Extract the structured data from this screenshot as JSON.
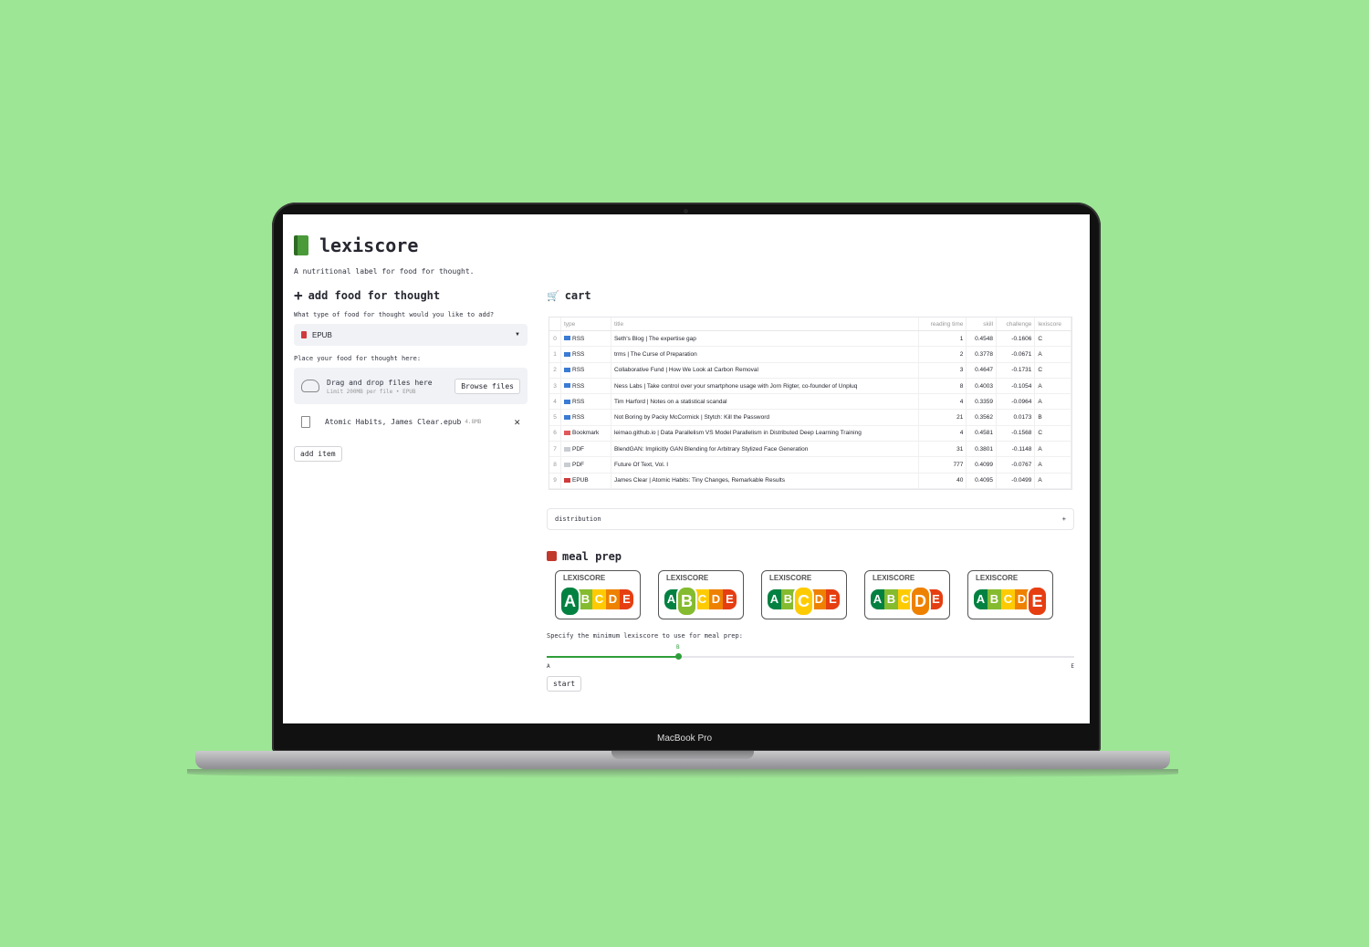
{
  "device_label": "MacBook Pro",
  "app": {
    "title": "lexiscore",
    "subtitle": "A nutritional label for food for thought."
  },
  "add_section": {
    "heading": "add food for thought",
    "type_prompt": "What type of food for thought would you like to add?",
    "selected_type": "EPUB",
    "upload_prompt": "Place your food for thought here:",
    "dropzone_text": "Drag and drop files here",
    "dropzone_limit": "Limit 200MB per file • EPUB",
    "browse_label": "Browse files",
    "file_name": "Atomic Habits, James Clear.epub",
    "file_size": "4.8MB",
    "add_button": "add item"
  },
  "cart": {
    "heading": "cart",
    "columns": [
      "type",
      "title",
      "reading time",
      "skill",
      "challenge",
      "lexiscore"
    ],
    "rows": [
      {
        "idx": "0",
        "type": "RSS",
        "icon_color": "#3a7bd5",
        "title": "Seth's Blog | The expertise gap",
        "time": "1",
        "skill": "0.4548",
        "challenge": "-0.1606",
        "score": "C"
      },
      {
        "idx": "1",
        "type": "RSS",
        "icon_color": "#3a7bd5",
        "title": "trms | The Curse of Preparation",
        "time": "2",
        "skill": "0.3778",
        "challenge": "-0.0671",
        "score": "A"
      },
      {
        "idx": "2",
        "type": "RSS",
        "icon_color": "#3a7bd5",
        "title": "Collaborative Fund | How We Look at Carbon Removal",
        "time": "3",
        "skill": "0.4647",
        "challenge": "-0.1731",
        "score": "C"
      },
      {
        "idx": "3",
        "type": "RSS",
        "icon_color": "#3a7bd5",
        "title": "Ness Labs | Take control over your smartphone usage with Jorn Rigter, co-founder of Unpluq",
        "time": "8",
        "skill": "0.4003",
        "challenge": "-0.1054",
        "score": "A"
      },
      {
        "idx": "4",
        "type": "RSS",
        "icon_color": "#3a7bd5",
        "title": "Tim Harford | Notes on a statistical scandal",
        "time": "4",
        "skill": "0.3359",
        "challenge": "-0.0964",
        "score": "A"
      },
      {
        "idx": "5",
        "type": "RSS",
        "icon_color": "#3a7bd5",
        "title": "Not Boring by Packy McCormick | Stytch: Kill the Password",
        "time": "21",
        "skill": "0.3562",
        "challenge": "0.0173",
        "score": "B"
      },
      {
        "idx": "6",
        "type": "Bookmark",
        "icon_color": "#e0585b",
        "title": "leimao.github.io | Data Parallelism VS Model Parallelism in Distributed Deep Learning Training",
        "time": "4",
        "skill": "0.4581",
        "challenge": "-0.1568",
        "score": "C"
      },
      {
        "idx": "7",
        "type": "PDF",
        "icon_color": "#c9ccd2",
        "title": "BlendGAN: Implicitly GAN Blending for Arbitrary Stylized Face Generation",
        "time": "31",
        "skill": "0.3801",
        "challenge": "-0.1148",
        "score": "A"
      },
      {
        "idx": "8",
        "type": "PDF",
        "icon_color": "#c9ccd2",
        "title": "Future Of Text, Vol. I",
        "time": "777",
        "skill": "0.4099",
        "challenge": "-0.0767",
        "score": "A"
      },
      {
        "idx": "9",
        "type": "EPUB",
        "icon_color": "#d13a3a",
        "title": "James Clear | Atomic Habits: Tiny Changes, Remarkable Results",
        "time": "40",
        "skill": "0.4095",
        "challenge": "-0.0499",
        "score": "A"
      }
    ],
    "expander_label": "distribution",
    "expander_toggle": "+"
  },
  "meal_prep": {
    "heading": "meal prep",
    "label_title": "LEXISCORE",
    "grades": [
      "A",
      "B",
      "C",
      "D",
      "E"
    ],
    "grade_colors": [
      "#038141",
      "#85bb2f",
      "#fecb02",
      "#ee8100",
      "#e63e11"
    ],
    "slider_prompt": "Specify the minimum lexiscore to use for meal prep:",
    "slider_min": "A",
    "slider_max": "E",
    "slider_value": "B",
    "slider_fraction": 0.25,
    "start_button": "start"
  }
}
